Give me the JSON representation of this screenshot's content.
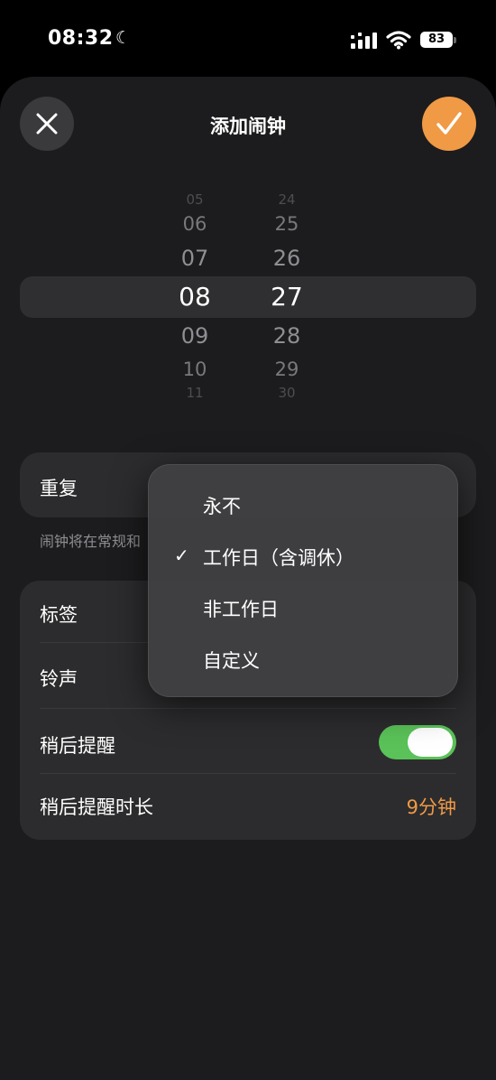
{
  "status": {
    "time": "08:32",
    "battery": "83"
  },
  "header": {
    "title": "添加闹钟"
  },
  "picker": {
    "hours": [
      "05",
      "06",
      "07",
      "08",
      "09",
      "10",
      "11"
    ],
    "minutes": [
      "24",
      "25",
      "26",
      "27",
      "28",
      "29",
      "30"
    ],
    "selected_hour": "08",
    "selected_minute": "27"
  },
  "repeat": {
    "label": "重复",
    "footnote": "闹钟将在常规和"
  },
  "settings": {
    "label_row": "标签",
    "ringtone_row": "铃声",
    "snooze_row": "稍后提醒",
    "snooze_enabled": true,
    "snooze_duration_row": "稍后提醒时长",
    "snooze_duration_value": "9分钟"
  },
  "repeat_menu": {
    "options": [
      "永不",
      "工作日（含调休）",
      "非工作日",
      "自定义"
    ],
    "selected": "工作日（含调休）"
  },
  "colors": {
    "accent": "#f09a45",
    "toggle_on": "#5ac258"
  }
}
